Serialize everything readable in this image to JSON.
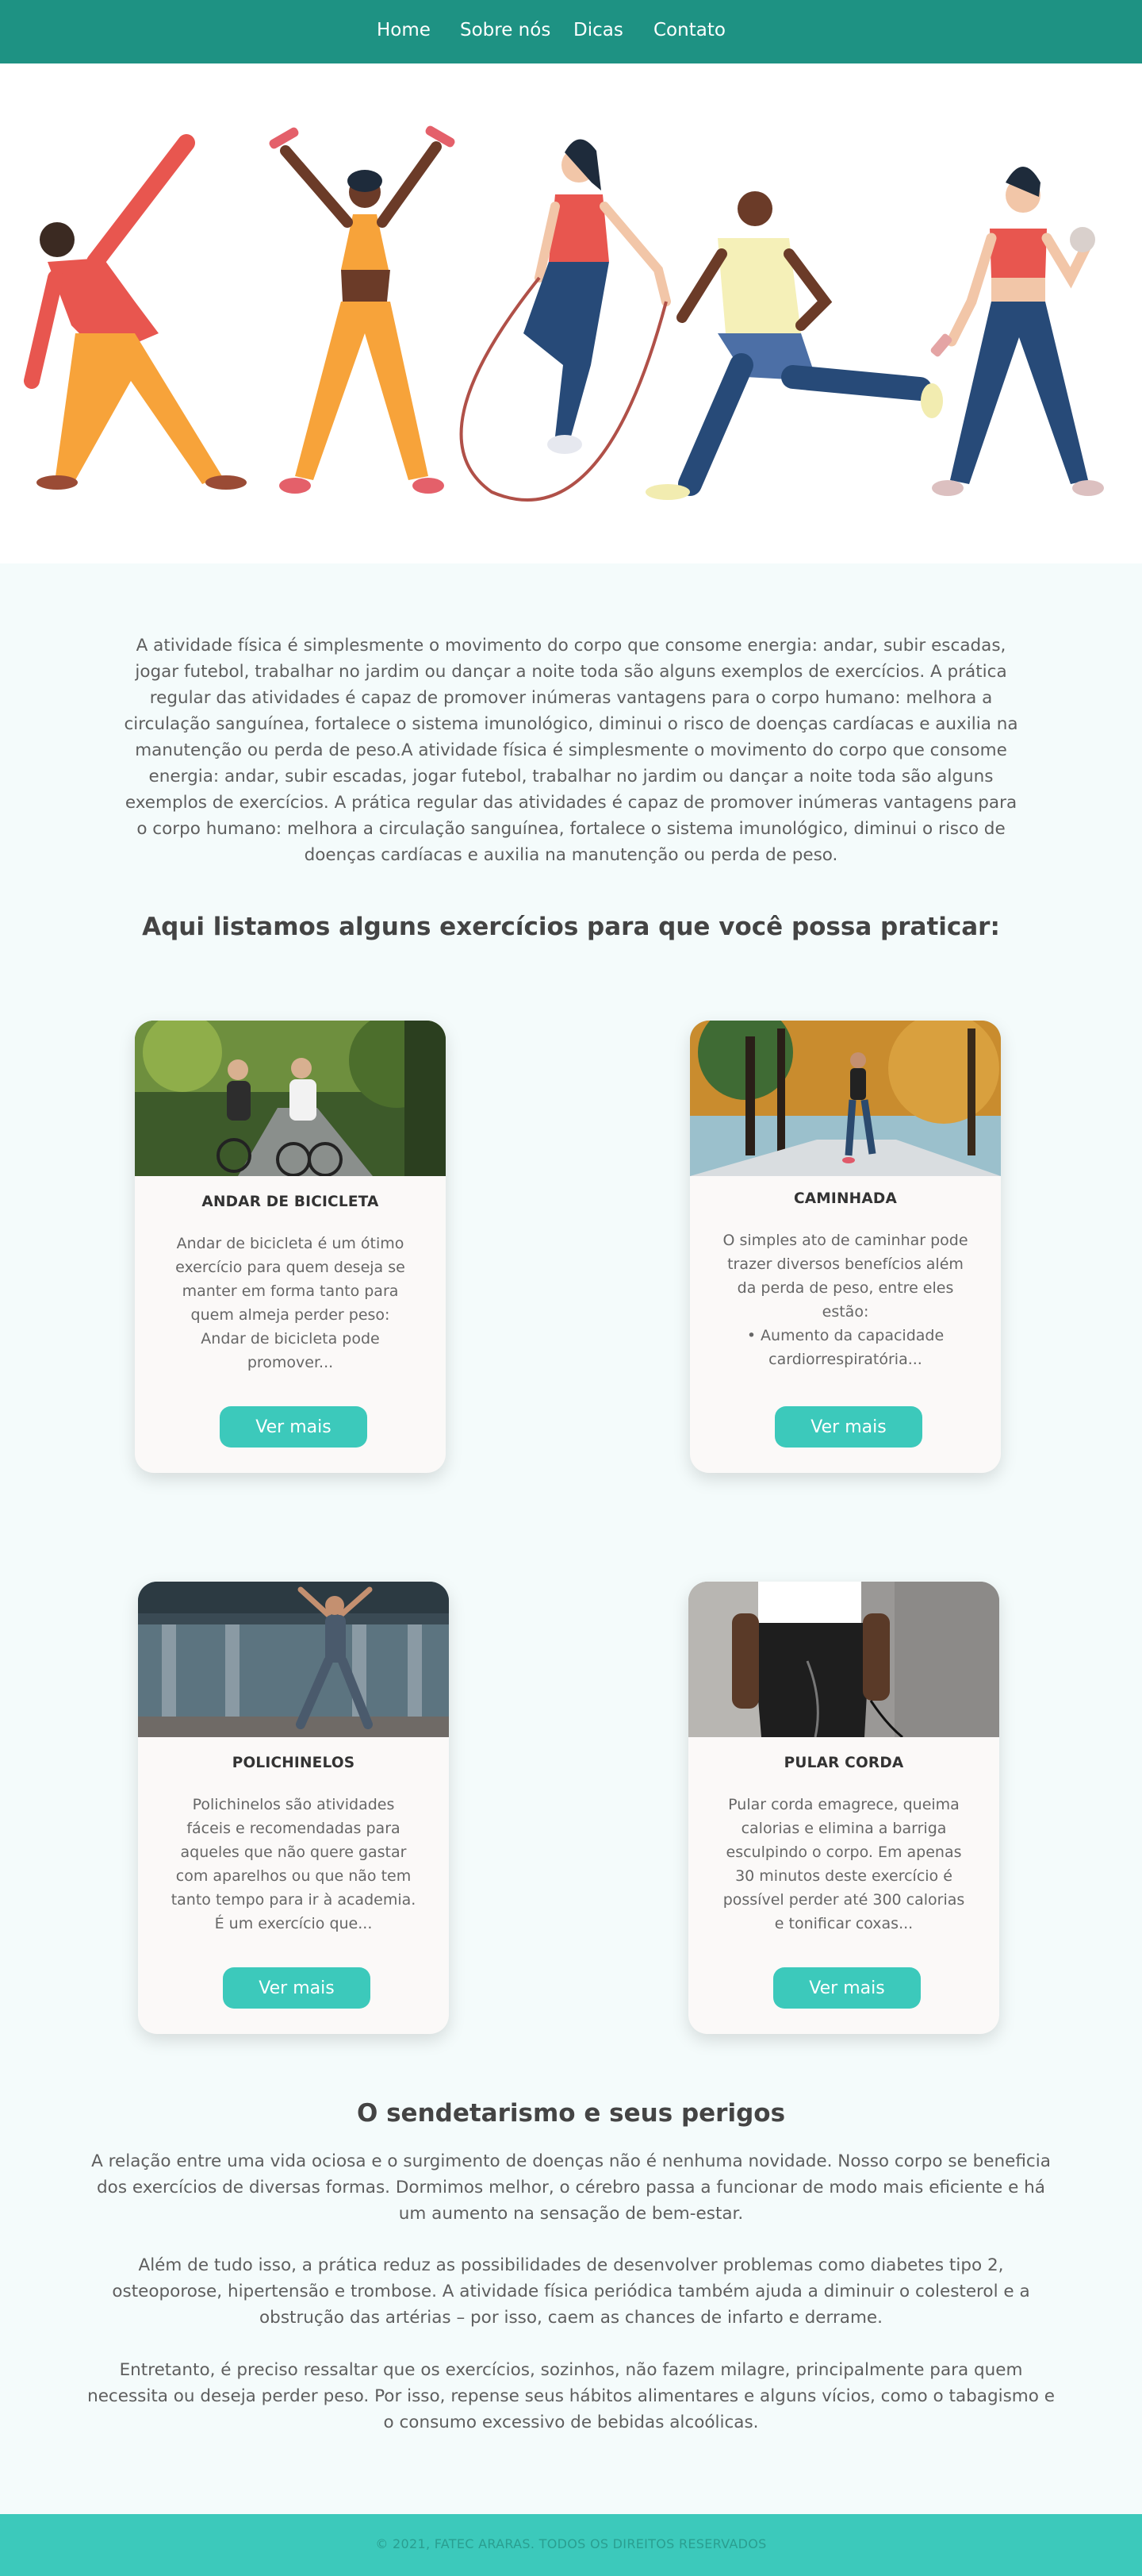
{
  "nav": {
    "items": [
      "Home",
      "Sobre nós",
      "Dicas",
      "Contato"
    ]
  },
  "hero": {
    "icon": "people-exercising-illustration"
  },
  "intro": {
    "text": "A atividade física é simplesmente o movimento do corpo que consome energia: andar, subir escadas, jogar futebol, trabalhar no jardim ou dançar a noite toda são alguns exemplos de exercícios.  A prática regular das atividades é capaz de promover inúmeras vantagens para o corpo humano: melhora a circulação sanguínea, fortalece o sistema imunológico, diminui o risco de doenças cardíacas e auxilia na manutenção ou perda de peso.A atividade física é simplesmente o movimento do corpo que consome energia: andar, subir escadas, jogar futebol, trabalhar no jardim ou dançar a noite toda são alguns exemplos de exercícios.  A prática regular das atividades é capaz de promover inúmeras vantagens para o corpo humano: melhora a circulação sanguínea, fortalece o sistema imunológico, diminui o risco de doenças cardíacas e auxilia na manutenção ou perda de peso."
  },
  "exercises_title": "Aqui listamos alguns exercícios para que você possa praticar:",
  "cards": [
    {
      "title": "ANDAR DE BICICLETA",
      "text": "Andar de bicicleta é um ótimo exercício para quem deseja se manter em forma tanto para quem almeja perder peso: Andar de bicicleta pode promover...",
      "button": "Ver mais",
      "image": "cycling-photo"
    },
    {
      "title": "CAMINHADA",
      "text": "O simples ato de caminhar pode trazer diversos benefícios além da perda de peso, entre eles estão:\n• Aumento da capacidade cardiorrespiratória...",
      "button": "Ver mais",
      "image": "walking-photo"
    },
    {
      "title": "POLICHINELOS",
      "text": "Polichinelos são atividades fáceis e recomendadas para aqueles que não quere gastar com aparelhos ou que não tem tanto tempo para ir à academia. É um exercício que...",
      "button": "Ver mais",
      "image": "jumping-jacks-photo"
    },
    {
      "title": "PULAR CORDA",
      "text": "Pular corda emagrece, queima calorias e elimina a barriga esculpindo o corpo. Em apenas 30 minutos deste exercício é possível perder até 300 calorias e tonificar coxas...",
      "button": "Ver mais",
      "image": "jump-rope-photo"
    }
  ],
  "sedentary": {
    "title": "O sendetarismo e seus perigos",
    "paragraphs": [
      "A relação entre uma vida ociosa e o surgimento de doenças não é nenhuma novidade. Nosso corpo se beneficia dos exercícios de diversas formas. Dormimos melhor, o cérebro passa a funcionar de modo mais eficiente e há um aumento na sensação de bem-estar.",
      "Além de tudo isso, a prática reduz as possibilidades de desenvolver problemas como diabetes tipo 2, osteoporose, hipertensão e trombose. A atividade física periódica também ajuda a diminuir o colesterol e a obstrução das artérias – por isso, caem as chances de infarto e derrame.",
      "Entretanto, é preciso ressaltar que os exercícios, sozinhos, não fazem milagre, principalmente para quem necessita ou deseja perder peso. Por isso, repense seus hábitos alimentares e alguns vícios, como o tabagismo e o consumo excessivo de bebidas alcoólicas."
    ]
  },
  "footer": {
    "text": "© 2021, FATEC ARARAS. TODOS OS DIREITOS RESERVADOS"
  },
  "colors": {
    "header": "#1e9283",
    "accent": "#3cc9bb",
    "background": "#f4fbfb"
  }
}
